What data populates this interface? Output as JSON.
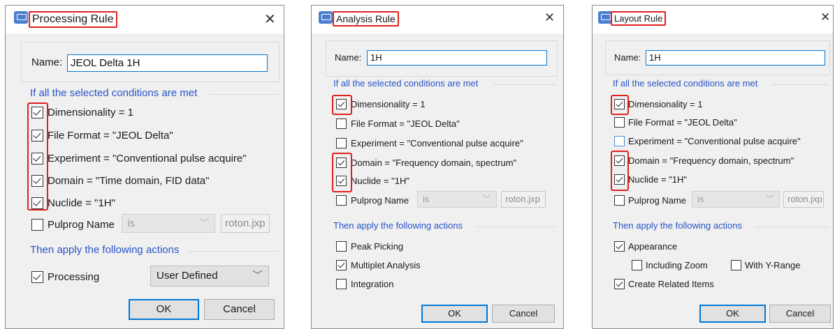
{
  "dialogs": [
    {
      "title": "Processing Rule",
      "close_icon": "close-icon",
      "name_label": "Name:",
      "name_value": "JEOL Delta 1H",
      "conditions_header": "If all the selected conditions are met",
      "conditions": [
        {
          "label": "Dimensionality = 1",
          "checked": true
        },
        {
          "label": "File Format = \"JEOL Delta\"",
          "checked": true
        },
        {
          "label": "Experiment = \"Conventional pulse acquire\"",
          "checked": true
        },
        {
          "label": "Domain = \"Time domain, FID data\"",
          "checked": true
        },
        {
          "label": "Nuclide = \"1H\"",
          "checked": true
        }
      ],
      "pulprog": {
        "label": "Pulprog Name",
        "checked": false,
        "operator": "is",
        "value": "roton.jxp"
      },
      "actions_header": "Then apply the following actions",
      "actions": [
        {
          "label": "Processing",
          "checked": true,
          "select_value": "User Defined"
        }
      ],
      "ok_label": "OK",
      "cancel_label": "Cancel"
    },
    {
      "title": "Analysis Rule",
      "close_icon": "close-icon",
      "name_label": "Name:",
      "name_value": "1H",
      "conditions_header": "If all the selected conditions are met",
      "conditions": [
        {
          "label": "Dimensionality = 1",
          "checked": true
        },
        {
          "label": "File Format = \"JEOL Delta\"",
          "checked": false
        },
        {
          "label": "Experiment = \"Conventional pulse acquire\"",
          "checked": false
        },
        {
          "label": "Domain = \"Frequency domain, spectrum\"",
          "checked": true
        },
        {
          "label": "Nuclide = \"1H\"",
          "checked": true
        }
      ],
      "pulprog": {
        "label": "Pulprog Name",
        "checked": false,
        "operator": "is",
        "value": "roton.jxp"
      },
      "actions_header": "Then apply the following actions",
      "actions": [
        {
          "label": "Peak Picking",
          "checked": false
        },
        {
          "label": "Multiplet Analysis",
          "checked": true
        },
        {
          "label": "Integration",
          "checked": false
        }
      ],
      "ok_label": "OK",
      "cancel_label": "Cancel"
    },
    {
      "title": "Layout Rule",
      "close_icon": "close-icon",
      "name_label": "Name:",
      "name_value": "1H",
      "conditions_header": "If all the selected conditions are met",
      "conditions": [
        {
          "label": "Dimensionality = 1",
          "checked": true
        },
        {
          "label": "File Format = \"JEOL Delta\"",
          "checked": false
        },
        {
          "label": "Experiment = \"Conventional pulse acquire\"",
          "checked": false
        },
        {
          "label": "Domain = \"Frequency domain, spectrum\"",
          "checked": true
        },
        {
          "label": "Nuclide = \"1H\"",
          "checked": true
        }
      ],
      "pulprog": {
        "label": "Pulprog Name",
        "checked": false,
        "operator": "is",
        "value": "roton.jxp"
      },
      "actions_header": "Then apply the following actions",
      "actions": [
        {
          "label": "Appearance",
          "checked": true
        },
        {
          "label": "Including Zoom",
          "checked": false
        },
        {
          "label": "With Y-Range",
          "checked": false
        },
        {
          "label": "Create Related Items",
          "checked": true
        }
      ],
      "ok_label": "OK",
      "cancel_label": "Cancel"
    }
  ]
}
